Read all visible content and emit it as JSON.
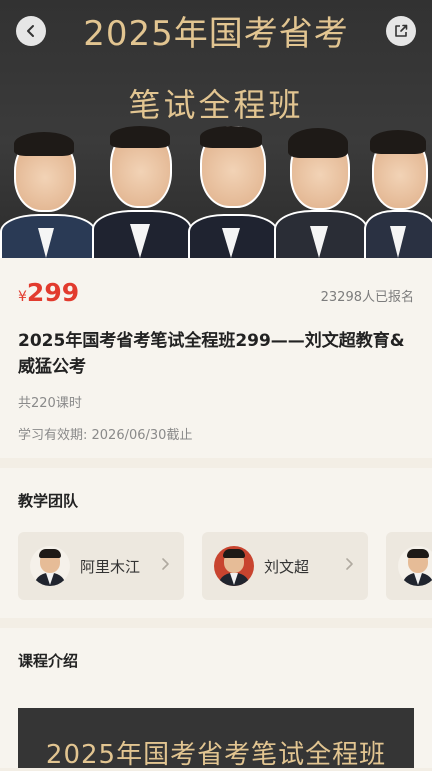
{
  "hero": {
    "title": "2025年国考省考",
    "subtitle": "笔试全程班"
  },
  "course": {
    "currency": "¥",
    "price": "299",
    "enrolled": "23298人已报名",
    "title": "2025年国考省考笔试全程班299——刘文超教育&威猛公考",
    "lessons": "共220课时",
    "validity": "学习有效期: 2026/06/30截止"
  },
  "team": {
    "heading": "教学团队",
    "teachers": [
      {
        "name": "阿里木江"
      },
      {
        "name": "刘文超"
      }
    ]
  },
  "intro": {
    "heading": "课程介绍",
    "banner_title": "2025年国考省考笔试全程班"
  },
  "icons": {
    "back": "chevron-left-icon",
    "share": "share-icon",
    "card_arrow": "chevron-right-icon"
  },
  "colors": {
    "price": "#e23b2e",
    "gold_text": "#e2c591",
    "hero_bg": "#333333",
    "page_bg": "#f3eee5"
  }
}
